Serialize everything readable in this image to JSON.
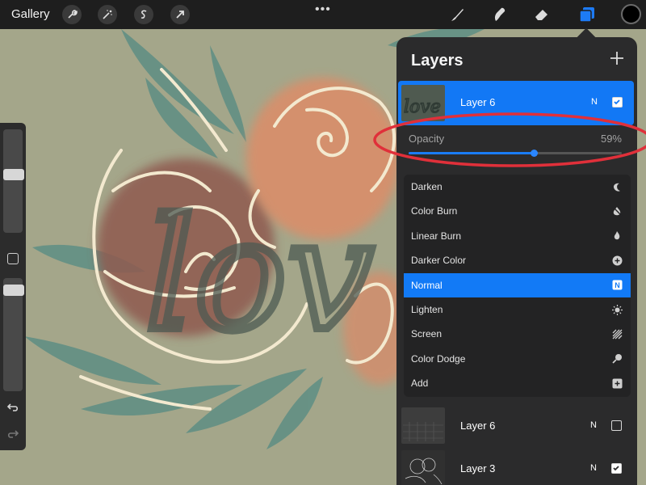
{
  "toolbar": {
    "gallery_label": "Gallery",
    "more_dots": "•••",
    "left_icons": [
      "wrench-icon",
      "magic-wand-icon",
      "selection-icon",
      "transform-arrow-icon"
    ],
    "right_icons": [
      "brush-icon",
      "smudge-icon",
      "eraser-icon",
      "layers-icon"
    ],
    "color_swatch": "#000000"
  },
  "canvas": {
    "background": "#a4a68a",
    "lettering_text": "love"
  },
  "sidebar": {
    "brush_size_level": 0.22,
    "brush_opacity_level": 0.3
  },
  "layers_panel": {
    "title": "Layers",
    "active_layer": {
      "name": "Layer 6",
      "blend_mode_letter": "N",
      "visible": true
    },
    "opacity": {
      "label": "Opacity",
      "value_text": "59%",
      "value": 0.59
    },
    "blend_modes": [
      {
        "label": "Darken",
        "icon": "moon-icon",
        "selected": false
      },
      {
        "label": "Color Burn",
        "icon": "burn-icon",
        "selected": false
      },
      {
        "label": "Linear Burn",
        "icon": "flame-icon",
        "selected": false
      },
      {
        "label": "Darker Color",
        "icon": "plus-circle-icon",
        "selected": false
      },
      {
        "label": "Normal",
        "icon": "normal-n-icon",
        "selected": true
      },
      {
        "label": "Lighten",
        "icon": "sun-icon",
        "selected": false
      },
      {
        "label": "Screen",
        "icon": "hatch-icon",
        "selected": false
      },
      {
        "label": "Color Dodge",
        "icon": "dodge-icon",
        "selected": false
      },
      {
        "label": "Add",
        "icon": "plus-square-icon",
        "selected": false
      }
    ],
    "normal_badge": "N",
    "layers": [
      {
        "name": "Layer 6",
        "blend_mode_letter": "N",
        "visible": false
      },
      {
        "name": "Layer 3",
        "blend_mode_letter": "N",
        "visible": true
      }
    ],
    "selected_color": "#1278f5"
  },
  "annotation": {
    "color": "#e0303a"
  }
}
